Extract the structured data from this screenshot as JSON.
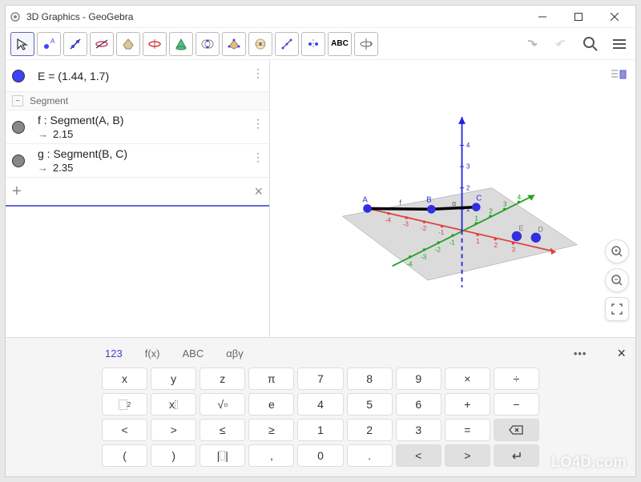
{
  "window": {
    "title": "3D Graphics - GeoGebra"
  },
  "toolbar": {
    "text_label": "ABC"
  },
  "algebra": {
    "point_e": "E = (1.44, 1.7)",
    "section_segment": "Segment",
    "segment_f": {
      "def": "f : Segment(A, B)",
      "val": "2.15"
    },
    "segment_g": {
      "def": "g : Segment(B, C)",
      "val": "2.35"
    }
  },
  "points": {
    "A": "A",
    "B": "B",
    "C": "C",
    "D": "D",
    "E": "E"
  },
  "labels": {
    "f": "f",
    "g": "g"
  },
  "axes": {
    "x": [
      "-4",
      "-3",
      "-2",
      "-1",
      "1",
      "2",
      "3"
    ],
    "y": [
      "-4",
      "-3",
      "-2",
      "-1",
      "1",
      "2",
      "3",
      "4"
    ],
    "z": [
      "1",
      "2",
      "3",
      "4"
    ]
  },
  "keyboard": {
    "tabs": [
      "123",
      "f(x)",
      "ABC",
      "αβγ"
    ],
    "rows": [
      [
        "x",
        "y",
        "z",
        "π",
        "7",
        "8",
        "9",
        "×",
        "÷"
      ],
      [
        "",
        "",
        "√▫",
        "e",
        "4",
        "5",
        "6",
        "+",
        "−"
      ],
      [
        "<",
        ">",
        "≤",
        "≥",
        "1",
        "2",
        "3",
        "=",
        ""
      ],
      [
        "(",
        ")",
        "",
        ",",
        "0",
        ".",
        "<",
        ">",
        ""
      ]
    ]
  },
  "watermark": "LO4D.com"
}
